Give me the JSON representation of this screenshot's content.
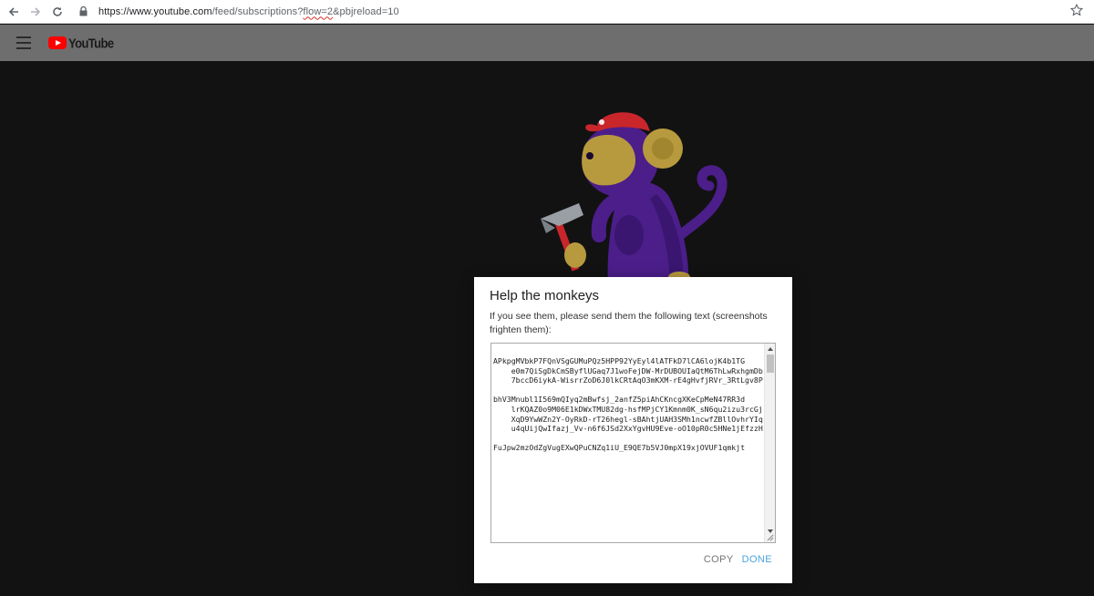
{
  "browser": {
    "url_host": "https://www.youtube.com",
    "url_path_before": "/feed/subscriptions?",
    "url_flagged": "flow=2",
    "url_path_after": "&pbjreload=10"
  },
  "masthead": {
    "logo_text": "YouTube"
  },
  "dialog": {
    "title": "Help the monkeys",
    "message": "If you see them, please send them the following text (screenshots frighten them):",
    "report_text": "APkpgMVbkP7FQnVSgGUMuPQz5HPP92YyEyl4lATFkD7lCA6lojK4b1TG\n    e0m7QiSgDkCmSByflUGaq7J1woFejDW-MrDUBOUIaQtM6ThLwRxhgmDb\n    7bccD6iykA-WisrrZoD6J0lkCRtAqO3mKXM-rE4gHvfjRVr_3RtLgv8P\n\nbhV3Mnubl1I569mQIyq2mBwfsj_2anfZ5piAhCKncgXKeCpMeN47RR3d\n    lrKQAZ0o9M06E1kDWxTMU82dg-hsfMPjCY1Kmnm0K_sN6qu2izu3rcGj\n    XqD9YwWZn2Y-OyRkD-rT26hegl-sBAhtjUAH3SMh1ncwfZBllOvhrYIq\n    u4qUijQwIfazj_Vv-n6f6JSd2XxYgvHU9Eve-oO10pR0c5HNe1jEfzzH\n\nFuJpw2mzOdZgVugEXwQPuCNZq1iU_E9QE7b5VJ0mpX19xjOVUF1qmkjt",
    "copy_label": "COPY",
    "done_label": "DONE"
  },
  "colors": {
    "page_bg": "#121212",
    "masthead_bg": "#6e6e6e",
    "youtube_red": "#ff0000",
    "monkey_purple": "#4b1e8a",
    "monkey_face": "#b89a3e",
    "hat_red": "#c8262b",
    "done_blue": "#4aa3df"
  }
}
